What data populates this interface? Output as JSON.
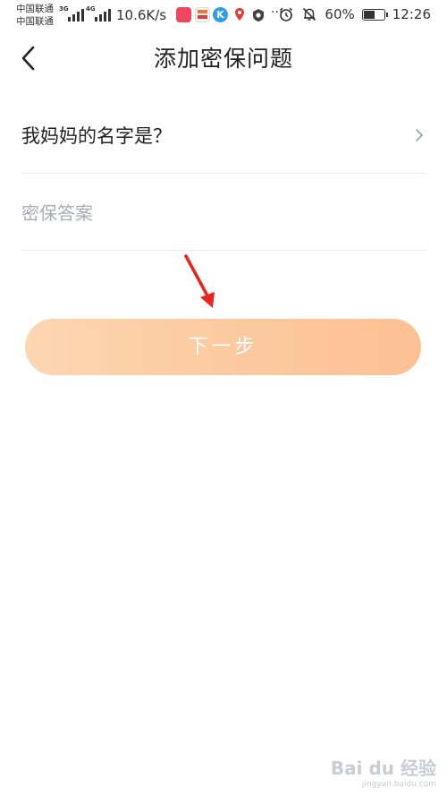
{
  "status_bar": {
    "carrier_1": "中国联通",
    "carrier_2": "中国联通",
    "network_1": "3G",
    "network_2": "4G",
    "speed": "10.6K/s",
    "battery_percent": "60%",
    "battery_level": 0.6,
    "time": "12:26",
    "more": "···"
  },
  "header": {
    "title": "添加密保问题"
  },
  "form": {
    "question_label": "我妈妈的名字是？",
    "answer_placeholder": "密保答案",
    "answer_value": ""
  },
  "actions": {
    "next_label": "下一步"
  },
  "watermark": {
    "brand": "Bai du 经验",
    "url": "jingyan.baidu.com"
  },
  "colors": {
    "button_gradient_start": "#fdd6b2",
    "button_gradient_end": "#fcc193",
    "annotation_arrow": "#e8261e",
    "placeholder": "#a8adb5"
  }
}
